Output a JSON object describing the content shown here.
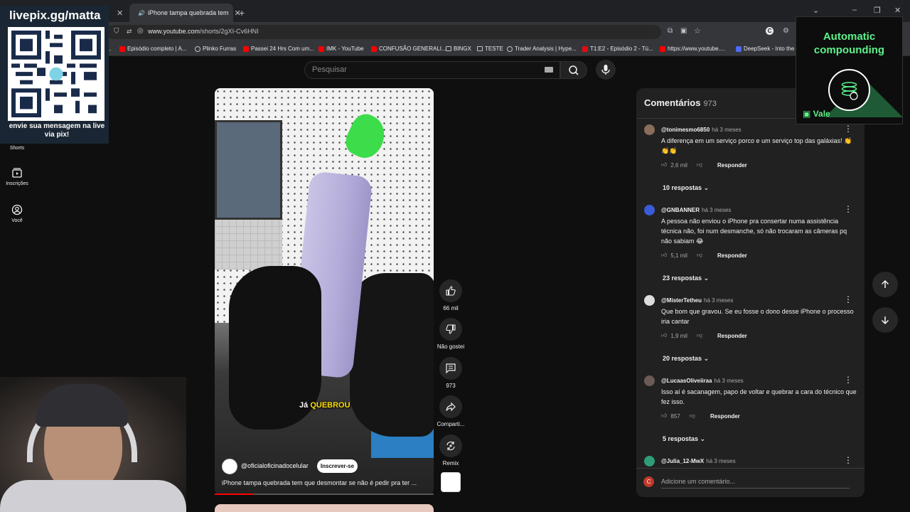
{
  "browser": {
    "tabs": [
      {
        "label": "",
        "active": false
      },
      {
        "label": "iPhone tampa quebrada tem",
        "active": true
      }
    ],
    "url_host": "www.youtube.com",
    "url_path": "/shorts/2gXI-Cv6HNI",
    "bookmarks": [
      "Episódio completo | A...",
      "Plinko Furras",
      "Passei 24 Hrs Com um...",
      "IMK - YouTube",
      "CONFUSÃO GENERALI...",
      "BINGX",
      "TESTE",
      "Trader Analysis | Hype...",
      "T1:E2 - Episódio 2 - Tú...",
      "https://www.youtube....",
      "DeepSeek - Into the"
    ]
  },
  "youtube": {
    "nav": {
      "shorts": "Shorts",
      "subscriptions": "Inscrições",
      "you": "Você"
    },
    "search_placeholder": "Pesquisar",
    "video": {
      "caption_pre": "Já",
      "caption_hl": "QUEBROU",
      "channel": "@oficialoficinadocelular",
      "subscribe": "Inscrever-se",
      "title": "iPhone tampa quebrada tem que desmontar se não é pedir pra ter ...",
      "progress": 0.18
    },
    "actions": {
      "likes": "66 mil",
      "dislike": "Não gostei",
      "comments": "973",
      "share": "Comparti...",
      "remix": "Remix"
    },
    "comments": {
      "title": "Comentários",
      "count": "973",
      "items": [
        {
          "user": "@tonimesmo6850",
          "ago": "há 3 meses",
          "text": "A diferença em um serviço porco e um serviço top das galáxias! 👏👏👏",
          "likes": "2,6 mil",
          "reply": "Responder",
          "replies": "10 respostas",
          "avatar_color": "#8a6d5a"
        },
        {
          "user": "@GNBANNER",
          "ago": "há 3 meses",
          "text": "A pessoa não enviou o iPhone pra consertar numa assistência técnica não, foi num desmanche, só não trocaram as câmeras pq não sabiam 😂",
          "likes": "5,1 mil",
          "reply": "Responder",
          "replies": "23 respostas",
          "avatar_color": "#3b5bdb"
        },
        {
          "user": "@MisterTetheu",
          "ago": "há 3 meses",
          "text": "Que bom que gravou. Se eu fosse o dono desse iPhone o processo iria cantar",
          "likes": "1,9 mil",
          "reply": "Responder",
          "replies": "20 respostas",
          "avatar_color": "#dddddd"
        },
        {
          "user": "@LucaasOliveiiraa",
          "ago": "há 3 meses",
          "text": "Isso aí é sacanagem, papo de voltar e quebrar a cara do técnico que fez isso.",
          "likes": "857",
          "reply": "Responder",
          "replies": "5 respostas",
          "avatar_color": "#6b5b55"
        },
        {
          "user": "@Julia_12-MwX",
          "ago": "há 3 meses",
          "avatar_color": "#2f9e77"
        }
      ],
      "add_placeholder": "Adicione um comentário...",
      "my_avatar_letter": "C"
    }
  },
  "overlays": {
    "qr_title": "livepix.gg/matta",
    "qr_subtitle": "envie sua mensagem na live via pix!",
    "ad_title": "Automatic compounding",
    "ad_brand": "Vale"
  }
}
